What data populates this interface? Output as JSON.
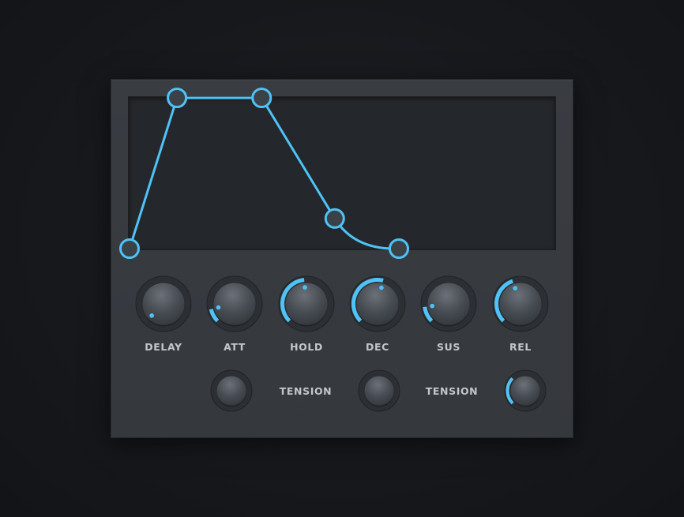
{
  "colors": {
    "accent": "#4fc3f7",
    "panel": "#383c41",
    "display": "#24272b",
    "background": "#16181c",
    "label": "#c3c7cc"
  },
  "envelope": {
    "points": [
      {
        "name": "start",
        "time": 0.0,
        "level": 0.0
      },
      {
        "name": "attack-peak",
        "time": 0.111,
        "level": 1.0
      },
      {
        "name": "hold-end",
        "time": 0.309,
        "level": 1.0
      },
      {
        "name": "decay-point",
        "time": 0.48,
        "level": 0.2
      },
      {
        "name": "release-end",
        "time": 0.63,
        "level": 0.0
      }
    ]
  },
  "knobs": [
    {
      "id": "delay",
      "label": "DELAY",
      "value": 0.0
    },
    {
      "id": "att",
      "label": "ATT",
      "value": 0.12
    },
    {
      "id": "hold",
      "label": "HOLD",
      "value": 0.48
    },
    {
      "id": "dec",
      "label": "DEC",
      "value": 0.55
    },
    {
      "id": "sus",
      "label": "SUS",
      "value": 0.14
    },
    {
      "id": "rel",
      "label": "REL",
      "value": 0.43
    }
  ],
  "tension": [
    {
      "id": "att-tension",
      "label": "",
      "value": 0.0
    },
    {
      "id": "dec-tension",
      "label": "TENSION",
      "value": 0.0
    },
    {
      "id": "rel-tension",
      "label": "TENSION",
      "value": 0.33
    }
  ]
}
